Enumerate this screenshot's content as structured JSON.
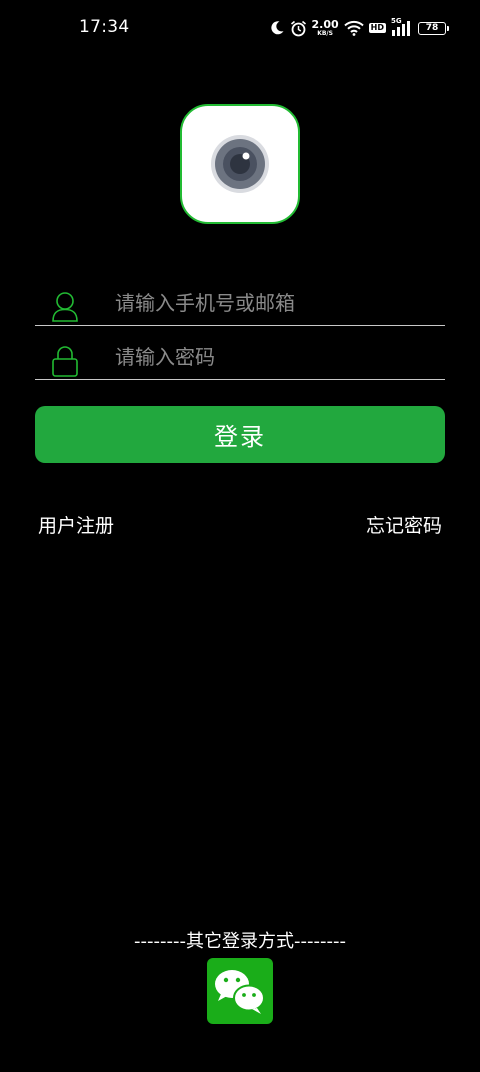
{
  "status_bar": {
    "time": "17:34",
    "net_speed_value": "2.00",
    "net_speed_unit": "KB/S",
    "hd_label": "HD",
    "network_label": "5G",
    "battery_level": "78",
    "icons": [
      "moon-icon",
      "alarm-icon",
      "wifi-icon",
      "hd-icon",
      "signal-icon",
      "battery-icon"
    ]
  },
  "logo": {
    "icon": "camera-lens-icon"
  },
  "form": {
    "account_placeholder": "请输入手机号或邮箱",
    "account_value": "",
    "password_placeholder": "请输入密码",
    "password_value": "",
    "account_icon": "user-icon",
    "password_icon": "lock-icon"
  },
  "login_button_label": "登录",
  "links": {
    "register": "用户注册",
    "forgot_password": "忘记密码"
  },
  "other_login": {
    "label": "--------其它登录方式--------",
    "wechat_icon": "wechat-icon"
  },
  "colors": {
    "background": "#000000",
    "accent_green": "#22a83e",
    "icon_green": "#22bb33",
    "wechat_green": "#1aad19",
    "placeholder": "#8a8a8a"
  }
}
